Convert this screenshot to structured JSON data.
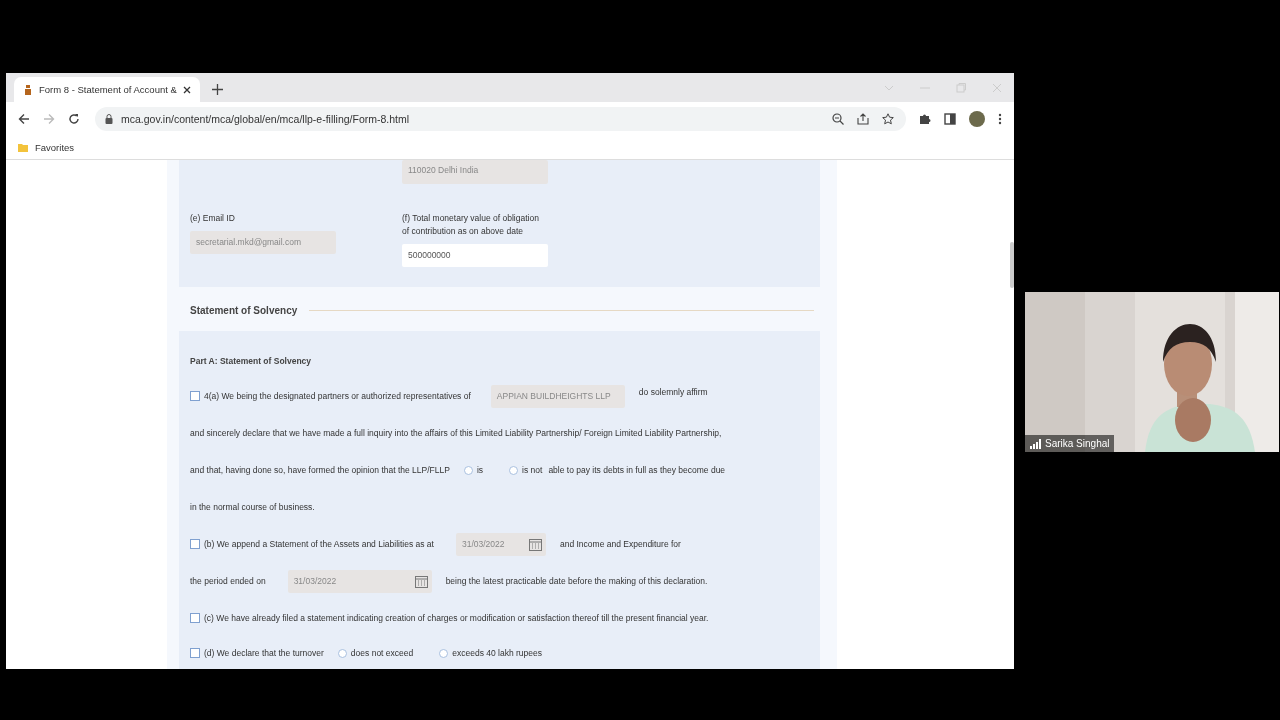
{
  "browser": {
    "tabs": [
      {
        "title": "Form 8 - Statement of Account &",
        "selected": true
      }
    ],
    "url": "mca.gov.in/content/mca/global/en/mca/llp-e-filling/Form-8.html",
    "bookmarks": [
      {
        "label": "Favorites"
      }
    ]
  },
  "form": {
    "address_tail": "110020 Delhi India",
    "fields": [
      {
        "label": "(e) Email ID",
        "value": "secretarial.mkd@gmail.com",
        "disabled": true
      },
      {
        "label": "(f) Total monetary value of obligation of contribution as on above date",
        "value": "500000000",
        "disabled": false
      }
    ],
    "section_title": "Statement of Solvency",
    "part_title": "Part A: Statement of Solvency",
    "declaration_a": {
      "checked": false,
      "lead": "4(a) We being the designated partners or authorized representatives of",
      "llp_name": "APPIAN BUILDHEIGHTS LLP",
      "lead_end": "do solemnly affirm",
      "line_2": "and sincerely declare that we have made a full inquiry into the affairs of this Limited Liability Partnership/ Foreign Limited Liability Partnership,",
      "line_3": "and that, having done so, have formed the opinion that the LLP/FLLP",
      "options": [
        {
          "label": "is",
          "selected": false
        },
        {
          "label": "is not",
          "selected": false
        }
      ],
      "line_3_end": "able to pay its debts in full as they become due",
      "line_4": "in the normal course of business."
    },
    "declaration_b": {
      "checked": false,
      "lead": "(b) We append a Statement of the Assets and Liabilities as at",
      "date_1": "31/03/2022",
      "lead_end": "and Income and Expenditure for",
      "line_2": "the period ended on",
      "date_2": "31/03/2022",
      "line_2_end": "being the latest practicable date before the making of this declaration."
    },
    "declaration_c": {
      "checked": false,
      "text": "(c) We have already filed a statement indicating creation of charges or modification or satisfaction thereof till the present financial year."
    },
    "declaration_d": {
      "checked": false,
      "lead": "(d) We declare that the turnover",
      "options": [
        {
          "label": "does not exceed",
          "selected": false
        },
        {
          "label": "exceeds 40 lakh rupees",
          "selected": false
        }
      ]
    }
  },
  "video": {
    "participant": "Sarika Singhal"
  }
}
